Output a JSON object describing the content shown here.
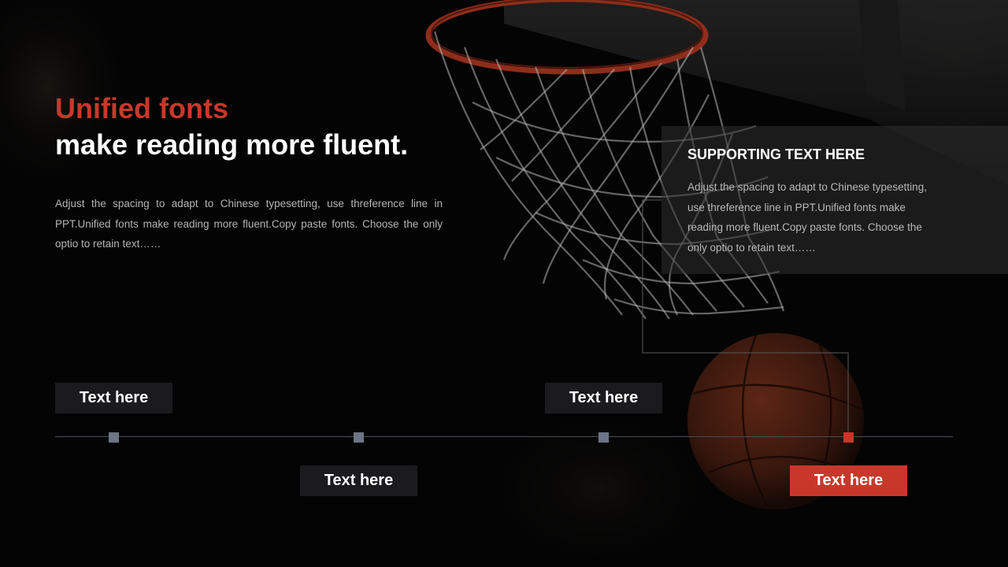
{
  "heading": {
    "accent": "Unified fonts",
    "main": "make reading more fluent."
  },
  "intro_text": "Adjust the spacing to adapt to Chinese typesetting, use threference line in PPT.Unified fonts make reading more fluent.Copy paste fonts. Choose the only optio to retain text……",
  "support_panel": {
    "heading": "SUPPORTING TEXT HERE",
    "body": "Adjust the spacing to adapt to Chinese typesetting, use threference line in PPT.Unified fonts make reading more fluent.Copy paste fonts. Choose the only optio to retain text……"
  },
  "timeline": {
    "items": [
      {
        "label": "Text here",
        "active": false
      },
      {
        "label": "Text here",
        "active": false
      },
      {
        "label": "Text here",
        "active": false
      },
      {
        "label": "Text here",
        "active": true
      }
    ]
  },
  "colors": {
    "accent": "#c8382a",
    "marker": "#6c7585",
    "background": "#050505"
  },
  "background_image": "basketball-hoop-photo"
}
